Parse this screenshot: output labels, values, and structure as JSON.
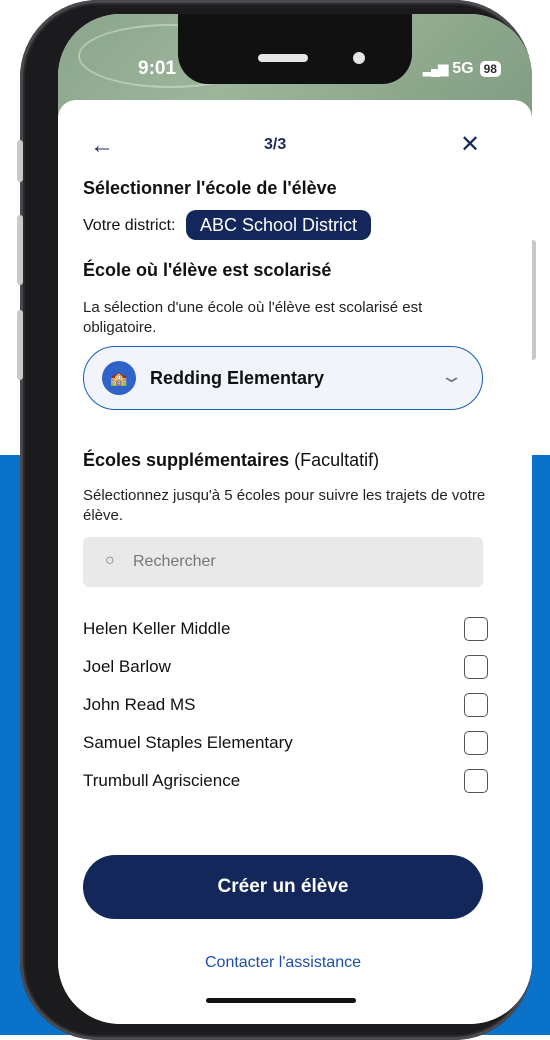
{
  "status_bar": {
    "time": "9:01",
    "network": "5G",
    "battery": "98"
  },
  "header": {
    "step": "3/3"
  },
  "district": {
    "title": "Sélectionner l'école de l'élève",
    "label": "Votre district:",
    "value": "ABC School District"
  },
  "enrolled_school": {
    "title": "École où l'élève est scolarisé",
    "description": "La sélection d'une école où l'élève est scolarisé est obligatoire.",
    "selected": "Redding Elementary"
  },
  "additional_schools": {
    "title": "Écoles supplémentaires",
    "optional": "(Facultatif)",
    "description": "Sélectionnez jusqu'à 5 écoles pour suivre les trajets de votre élève.",
    "search_placeholder": "Rechercher",
    "items": [
      {
        "name": "Helen Keller Middle",
        "checked": false
      },
      {
        "name": "Joel Barlow",
        "checked": false
      },
      {
        "name": "John Read MS",
        "checked": false
      },
      {
        "name": "Samuel Staples Elementary",
        "checked": false
      },
      {
        "name": "Trumbull Agriscience",
        "checked": false
      }
    ]
  },
  "actions": {
    "create_label": "Créer un élève",
    "support_label": "Contacter l'assistance"
  },
  "colors": {
    "navy": "#13275a",
    "blue_bg": "#0a72c8",
    "link": "#1d4fa8"
  }
}
